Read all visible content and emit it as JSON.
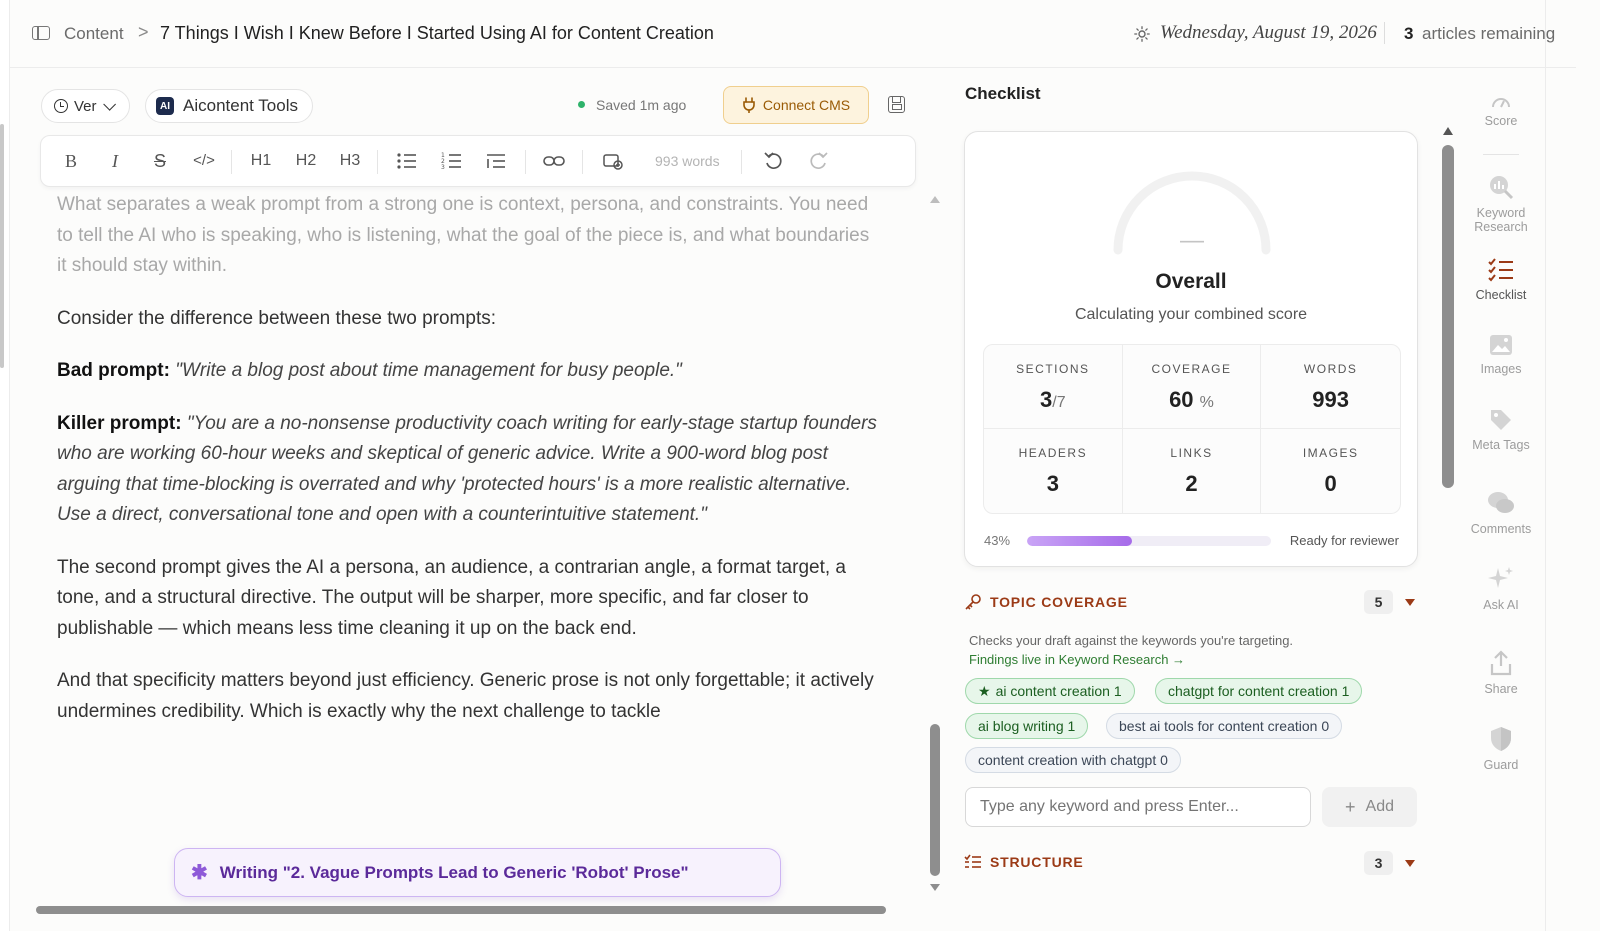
{
  "breadcrumb": {
    "root": "Content",
    "separator": ">",
    "title": "7 Things I Wish I Knew Before I Started Using AI for Content Creation"
  },
  "header": {
    "date": "Wednesday, August 19, 2026",
    "remaining_count": "3",
    "remaining_label": "articles remaining"
  },
  "toolbar": {
    "version_label": "Ver",
    "tools_logo": "AI",
    "tools_label": "Aicontent Tools",
    "saved_status": "Saved 1m ago",
    "connect_cms_label": "Connect CMS",
    "word_count": "993 words",
    "format": {
      "bold": "B",
      "italic": "I",
      "strike": "S",
      "code": "</>",
      "h1": "H1",
      "h2": "H2",
      "h3": "H3"
    }
  },
  "editor": {
    "p1": "What separates a weak prompt from a strong one is context, persona, and constraints. You need to tell the AI who is speaking, who is listening, what the goal of the piece is, and what boundaries it should stay within.",
    "p2": "Consider the difference between these two prompts:",
    "bad_label": "Bad prompt:",
    "bad_text": "\"Write a blog post about time management for busy people.\"",
    "killer_label": "Killer prompt:",
    "killer_text": "\"You are a no-nonsense productivity coach writing for early-stage startup founders who are working 60-hour weeks and skeptical of generic advice. Write a 900-word blog post arguing that time-blocking is overrated and why 'protected hours' is a more realistic alternative. Use a direct, conversational tone and open with a counterintuitive statement.\"",
    "p3": "The second prompt gives the AI a persona, an audience, a contrarian angle, a format target, a tone, and a structural directive. The output will be sharper, more specific, and far closer to publishable — which means less time cleaning it up on the back end.",
    "p4": "And that specificity matters beyond just efficiency. Generic prose is not only forgettable; it actively undermines credibility. Which is exactly why the next challenge to tackle"
  },
  "writing_status": "Writing \"2. Vague Prompts Lead to Generic 'Robot' Prose\"",
  "checklist": {
    "title": "Checklist",
    "gauge_value": "—",
    "overall_label": "Overall",
    "overall_sub": "Calculating your combined score",
    "stats": [
      {
        "label": "SECTIONS",
        "value": "3",
        "suffix": "/7"
      },
      {
        "label": "COVERAGE",
        "value": "60",
        "suffix": "%"
      },
      {
        "label": "WORDS",
        "value": "993",
        "suffix": ""
      },
      {
        "label": "HEADERS",
        "value": "3",
        "suffix": ""
      },
      {
        "label": "LINKS",
        "value": "2",
        "suffix": ""
      },
      {
        "label": "IMAGES",
        "value": "0",
        "suffix": ""
      }
    ],
    "progress_label": "43%",
    "progress_fraction": 0.43,
    "ready_label": "Ready for reviewer",
    "topic_coverage": {
      "title": "TOPIC COVERAGE",
      "count": "5",
      "description": "Checks your draft against the keywords you're targeting.",
      "link": "Findings live in Keyword Research →",
      "keywords": [
        {
          "text": "ai content creation",
          "count": "1",
          "starred": true
        },
        {
          "text": "chatgpt for content creation",
          "count": "1",
          "starred": false
        },
        {
          "text": "ai blog writing",
          "count": "1",
          "starred": false
        },
        {
          "text": "best ai tools for content creation",
          "count": "0",
          "starred": false
        },
        {
          "text": "content creation with chatgpt",
          "count": "0",
          "starred": false
        }
      ],
      "input_placeholder": "Type any keyword and press Enter...",
      "add_label": "Add"
    },
    "structure": {
      "title": "STRUCTURE",
      "count": "3"
    }
  },
  "rail": [
    {
      "label": "Score",
      "icon": "gauge-icon"
    },
    {
      "label": "Keyword Research",
      "icon": "keyword-research-icon"
    },
    {
      "label": "Checklist",
      "icon": "checklist-icon"
    },
    {
      "label": "Images",
      "icon": "image-icon"
    },
    {
      "label": "Meta Tags",
      "icon": "tag-icon"
    },
    {
      "label": "Comments",
      "icon": "comments-icon"
    },
    {
      "label": "Ask AI",
      "icon": "sparkle-icon"
    },
    {
      "label": "Share",
      "icon": "share-icon"
    },
    {
      "label": "Guard",
      "icon": "shield-icon"
    }
  ],
  "colors": {
    "accent": "#9b3a16",
    "cms_bg": "#fdf3de",
    "writing_purple": "#5b2a9a",
    "keyword_green": "#1b5e20",
    "progress": "#a66be9"
  }
}
